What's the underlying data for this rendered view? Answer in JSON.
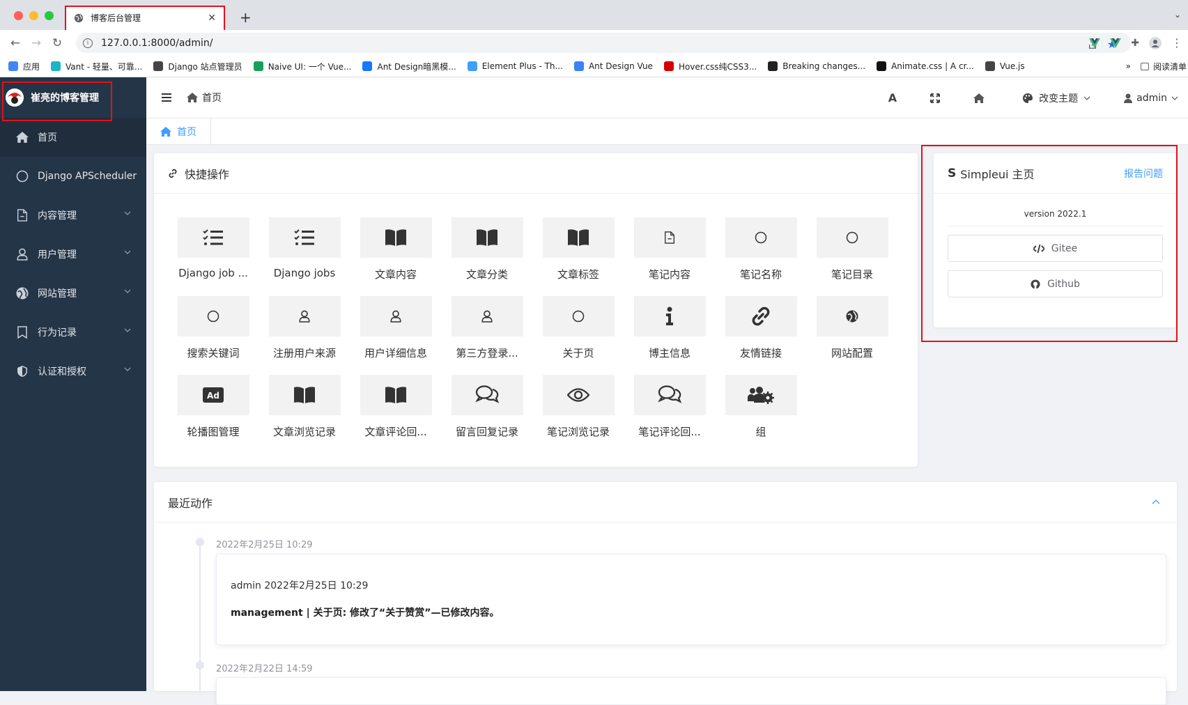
{
  "browser": {
    "tab_title": "博客后台管理",
    "url": "127.0.0.1:8000/admin/",
    "bookmarks": [
      {
        "label": "应用",
        "color": "#4285f4"
      },
      {
        "label": "Vant - 轻量、可靠...",
        "color": "#1bb5c8"
      },
      {
        "label": "Django 站点管理员",
        "color": "#444"
      },
      {
        "label": "Naive UI: 一个 Vue...",
        "color": "#18a058"
      },
      {
        "label": "Ant Design暗黑模...",
        "color": "#1677ff"
      },
      {
        "label": "Element Plus - Th...",
        "color": "#409eff"
      },
      {
        "label": "Ant Design Vue",
        "color": "#3b82f6"
      },
      {
        "label": "Hover.css纯CSS3...",
        "color": "#d60000"
      },
      {
        "label": "Breaking changes...",
        "color": "#222"
      },
      {
        "label": "Animate.css | A cr...",
        "color": "#111"
      },
      {
        "label": "Vue.js",
        "color": "#444"
      }
    ],
    "more": "»",
    "reading_list": "阅读清单"
  },
  "sidebar": {
    "title": "崔亮的博客管理",
    "items": [
      {
        "label": "首页",
        "icon": "home-icon",
        "has_arrow": false
      },
      {
        "label": "Django APScheduler",
        "icon": "circle-icon",
        "has_arrow": false
      },
      {
        "label": "内容管理",
        "icon": "file-icon",
        "has_arrow": true
      },
      {
        "label": "用户管理",
        "icon": "user-icon",
        "has_arrow": true
      },
      {
        "label": "网站管理",
        "icon": "globe-icon",
        "has_arrow": true
      },
      {
        "label": "行为记录",
        "icon": "bookmark-icon",
        "has_arrow": true
      },
      {
        "label": "认证和授权",
        "icon": "shield-icon",
        "has_arrow": true
      }
    ]
  },
  "header": {
    "breadcrumb": "首页",
    "font_btn": "A",
    "theme_label": "改变主题",
    "user_label": "admin"
  },
  "tabs": {
    "home": "首页"
  },
  "quick": {
    "title": "快捷操作",
    "items": [
      {
        "label": "Django job ...",
        "icon": "list-icon"
      },
      {
        "label": "Django jobs",
        "icon": "list-icon"
      },
      {
        "label": "文章内容",
        "icon": "book-icon"
      },
      {
        "label": "文章分类",
        "icon": "book-icon"
      },
      {
        "label": "文章标签",
        "icon": "book-icon"
      },
      {
        "label": "笔记内容",
        "icon": "file-icon"
      },
      {
        "label": "笔记名称",
        "icon": "circle-icon"
      },
      {
        "label": "笔记目录",
        "icon": "circle-icon"
      },
      {
        "label": "搜索关键词",
        "icon": "circle-icon"
      },
      {
        "label": "注册用户来源",
        "icon": "user-icon"
      },
      {
        "label": "用户详细信息",
        "icon": "user-icon"
      },
      {
        "label": "第三方登录...",
        "icon": "user-icon"
      },
      {
        "label": "关于页",
        "icon": "circle-icon"
      },
      {
        "label": "博主信息",
        "icon": "info-icon"
      },
      {
        "label": "友情链接",
        "icon": "link-icon"
      },
      {
        "label": "网站配置",
        "icon": "globe-icon"
      },
      {
        "label": "轮播图管理",
        "icon": "ad-icon"
      },
      {
        "label": "文章浏览记录",
        "icon": "book-icon"
      },
      {
        "label": "文章评论回...",
        "icon": "book-icon"
      },
      {
        "label": "留言回复记录",
        "icon": "comments-icon"
      },
      {
        "label": "笔记浏览记录",
        "icon": "eye-icon"
      },
      {
        "label": "笔记评论回...",
        "icon": "comments-icon"
      },
      {
        "label": "组",
        "icon": "users-cog-icon"
      }
    ]
  },
  "simpleui": {
    "title": "Simpleui 主页",
    "report": "报告问题",
    "version": "version 2022.1",
    "gitee": "Gitee",
    "github": "Github"
  },
  "recent": {
    "title": "最近动作",
    "entries": [
      {
        "time": "2022年2月25日 10:29",
        "title": "admin 2022年2月25日 10:29",
        "body": "management | 关于页: 修改了“关于赞赏”—已修改内容。"
      },
      {
        "time": "2022年2月22日 14:59"
      }
    ]
  },
  "colors": {
    "sidebar_bg": "#253548",
    "accent": "#409eff",
    "highlight": "#e5101b"
  }
}
